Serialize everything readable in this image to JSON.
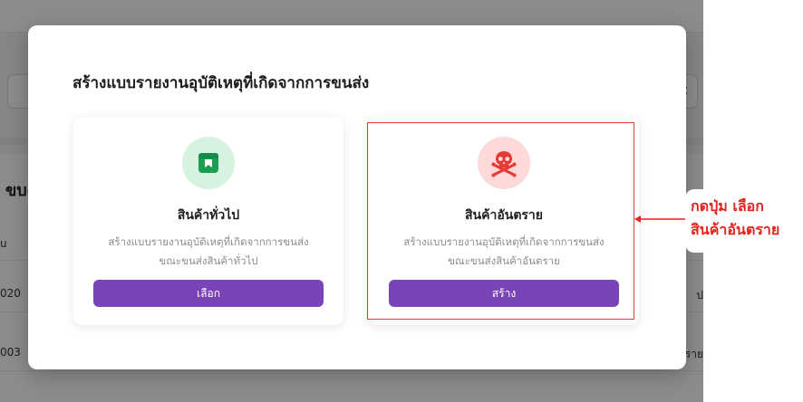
{
  "background": {
    "search_right_text": "c",
    "section_title": "ขบd",
    "table_header_partial": "u",
    "rows": [
      {
        "left": "020",
        "right": "ป"
      },
      {
        "left": "003",
        "right": "ตราย"
      }
    ]
  },
  "modal": {
    "title": "สร้างแบบรายงานอุบัติเหตุที่เกิดจากการขนส่ง",
    "options": [
      {
        "icon": "box-icon",
        "icon_color": "#16a34a",
        "title": "สินค้าทั่วไป",
        "description_line1": "สร้างแบบรายงานอุบัติเหตุที่เกิดจากการขนส่ง",
        "description_line2": "ขณะขนส่งสินค้าทั่วไป",
        "button_label": "เลือก"
      },
      {
        "icon": "skull-crossbones-icon",
        "icon_color": "#e53935",
        "title": "สินค้าอันตราย",
        "description_line1": "สร้างแบบรายงานอุบัติเหตุที่เกิดจากการขนส่ง",
        "description_line2": "ขณะขนส่งสินค้าอันตราย",
        "button_label": "สร้าง"
      }
    ]
  },
  "annotation": {
    "line1": "กดปุ่ม เลือก",
    "line2": "สินค้าอันตราย",
    "color": "#e8221c"
  },
  "colors": {
    "primary_button": "#7b43b8",
    "overlay": "rgba(0,0,0,0.45)"
  }
}
